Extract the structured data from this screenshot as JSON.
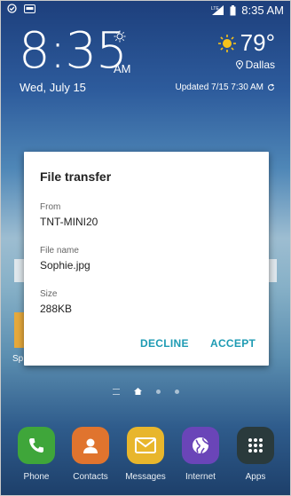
{
  "status_bar": {
    "time": "8:35 AM",
    "network": "LTE"
  },
  "clock": {
    "time": "8:35",
    "ampm": "AM",
    "date": "Wed, July 15"
  },
  "weather": {
    "temperature": "79°",
    "location": "Dallas",
    "updated": "Updated  7/15  7:30 AM"
  },
  "behind_dialog": {
    "app_label_fragment": "Sp"
  },
  "dialog": {
    "title": "File transfer",
    "fields": [
      {
        "label": "From",
        "value": "TNT-MINI20"
      },
      {
        "label": "File name",
        "value": "Sophie.jpg"
      },
      {
        "label": "Size",
        "value": "288KB"
      }
    ],
    "decline_label": "DECLINE",
    "accept_label": "ACCEPT"
  },
  "dock": [
    {
      "label": "Phone",
      "icon": "phone-icon",
      "color": "#3fa63a"
    },
    {
      "label": "Contacts",
      "icon": "contacts-icon",
      "color": "#e0742e"
    },
    {
      "label": "Messages",
      "icon": "messages-icon",
      "color": "#e8b62c"
    },
    {
      "label": "Internet",
      "icon": "internet-icon",
      "color": "#6a45b8"
    },
    {
      "label": "Apps",
      "icon": "apps-icon",
      "color": "#2a3a3c"
    }
  ]
}
